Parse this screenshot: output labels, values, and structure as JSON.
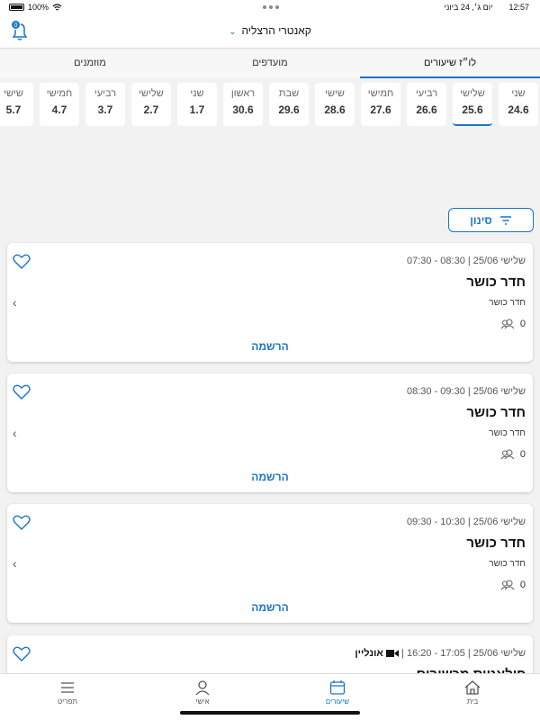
{
  "status": {
    "battery": "100%",
    "time": "12:57",
    "date": "יום ג׳, 24 ביוני"
  },
  "header": {
    "club": "קאנטרי הרצליה",
    "notif_count": "0"
  },
  "tabs": [
    {
      "label": "לו״ז שיעורים",
      "active": true
    },
    {
      "label": "מועדפים",
      "active": false
    },
    {
      "label": "מוזמנים",
      "active": false
    }
  ],
  "days": [
    {
      "name": "שני",
      "date": "24.6"
    },
    {
      "name": "שלישי",
      "date": "25.6"
    },
    {
      "name": "רביעי",
      "date": "26.6"
    },
    {
      "name": "חמישי",
      "date": "27.6"
    },
    {
      "name": "שישי",
      "date": "28.6"
    },
    {
      "name": "שבת",
      "date": "29.6"
    },
    {
      "name": "ראשון",
      "date": "30.6"
    },
    {
      "name": "שני",
      "date": "1.7"
    },
    {
      "name": "שלישי",
      "date": "2.7"
    },
    {
      "name": "רביעי",
      "date": "3.7"
    },
    {
      "name": "חמישי",
      "date": "4.7"
    },
    {
      "name": "שישי",
      "date": "5.7"
    }
  ],
  "selected_day": 1,
  "filter_label": "סינון",
  "cards": [
    {
      "meta": "שלישי 25/06 | 08:30 - 07:30",
      "title": "חדר כושר",
      "sub": "חדר כושר",
      "count": "0",
      "register": "הרשמה"
    },
    {
      "meta": "שלישי 25/06 | 09:30 - 08:30",
      "title": "חדר כושר",
      "sub": "חדר כושר",
      "count": "0",
      "register": "הרשמה"
    },
    {
      "meta": "שלישי 25/06 | 10:30 - 09:30",
      "title": "חדר כושר",
      "sub": "חדר כושר",
      "count": "0",
      "register": "הרשמה"
    },
    {
      "meta": "שלישי 25/06 | 17:05 - 16:20 |",
      "online": "אונליין",
      "title": "פילאטיס מכשירים",
      "sub": "",
      "count": "",
      "register": ""
    }
  ],
  "nav": {
    "home": "בית",
    "classes": "שיעורים",
    "personal": "אישי",
    "menu": "תפריט"
  },
  "colors": {
    "accent": "#1a73c9"
  }
}
